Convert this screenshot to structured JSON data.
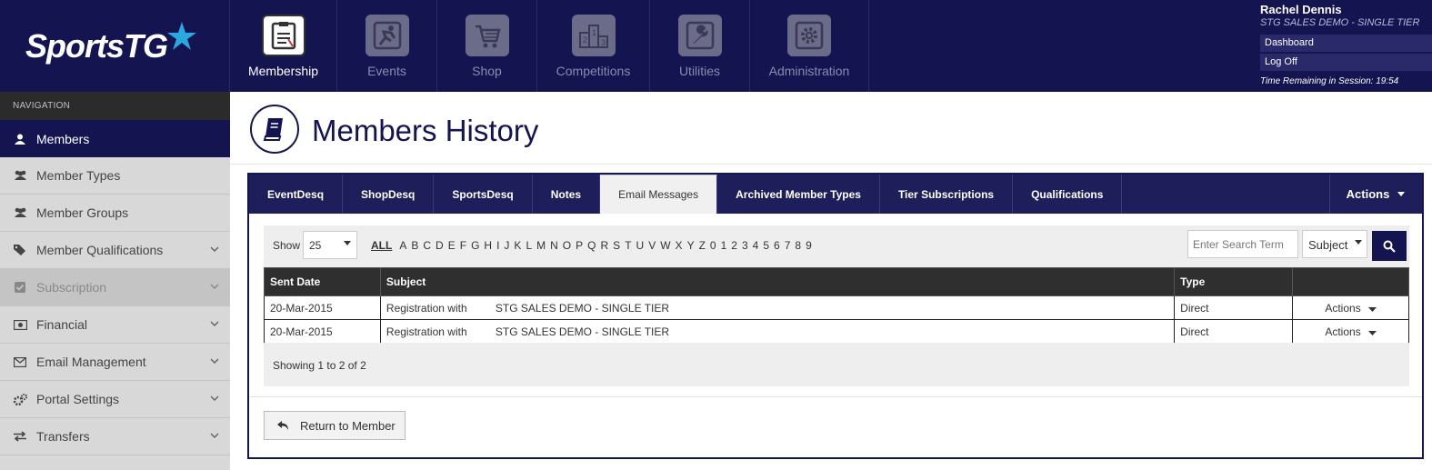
{
  "brand": {
    "name": "SportsTG"
  },
  "topnav": [
    {
      "label": "Membership",
      "icon": "clipboard-icon",
      "active": true
    },
    {
      "label": "Events",
      "icon": "runner-icon",
      "active": false
    },
    {
      "label": "Shop",
      "icon": "cart-icon",
      "active": false
    },
    {
      "label": "Competitions",
      "icon": "podium-icon",
      "active": false
    },
    {
      "label": "Utilities",
      "icon": "wrench-icon",
      "active": false
    },
    {
      "label": "Administration",
      "icon": "gear-icon",
      "active": false
    }
  ],
  "user": {
    "name": "Rachel Dennis",
    "org": "STG SALES DEMO - SINGLE TIER",
    "dashboard_label": "Dashboard",
    "logoff_label": "Log Off",
    "session": "Time Remaining in Session: 19:54"
  },
  "sidebar": {
    "heading": "NAVIGATION",
    "items": [
      {
        "label": "Members",
        "icon": "user-icon"
      },
      {
        "label": "Member Types",
        "icon": "users-icon"
      },
      {
        "label": "Member Groups",
        "icon": "users-icon"
      },
      {
        "label": "Member Qualifications",
        "icon": "tags-icon"
      },
      {
        "label": "Subscription",
        "icon": "checkbox-icon"
      },
      {
        "label": "Financial",
        "icon": "money-icon"
      },
      {
        "label": "Email Management",
        "icon": "envelope-icon"
      },
      {
        "label": "Portal Settings",
        "icon": "cogs-icon"
      },
      {
        "label": "Transfers",
        "icon": "exchange-icon"
      }
    ]
  },
  "page": {
    "title": "Members History",
    "icon": "book-icon"
  },
  "tabs": [
    {
      "label": "EventDesq"
    },
    {
      "label": "ShopDesq"
    },
    {
      "label": "SportsDesq"
    },
    {
      "label": "Notes"
    },
    {
      "label": "Email Messages"
    },
    {
      "label": "Archived Member Types"
    },
    {
      "label": "Tier Subscriptions"
    },
    {
      "label": "Qualifications"
    }
  ],
  "tab_actions_label": "Actions",
  "filter": {
    "show_label": "Show",
    "show_value": "25",
    "alpha_all": "ALL",
    "alpha": [
      "A",
      "B",
      "C",
      "D",
      "E",
      "F",
      "G",
      "H",
      "I",
      "J",
      "K",
      "L",
      "M",
      "N",
      "O",
      "P",
      "Q",
      "R",
      "S",
      "T",
      "U",
      "V",
      "W",
      "X",
      "Y",
      "Z",
      "0",
      "1",
      "2",
      "3",
      "4",
      "5",
      "6",
      "7",
      "8",
      "9"
    ],
    "search_placeholder": "Enter Search Term",
    "search_field": "Subject"
  },
  "table": {
    "headers": {
      "sent_date": "Sent Date",
      "subject": "Subject",
      "type": "Type",
      "actions": ""
    },
    "rows": [
      {
        "sent_date": "20-Mar-2015",
        "subject_a": "Registration with",
        "subject_b": "STG SALES DEMO - SINGLE TIER",
        "type": "Direct",
        "actions": "Actions"
      },
      {
        "sent_date": "20-Mar-2015",
        "subject_a": "Registration with",
        "subject_b": "STG SALES DEMO - SINGLE TIER",
        "type": "Direct",
        "actions": "Actions"
      }
    ],
    "footer": "Showing 1 to 2 of 2"
  },
  "return_button": "Return to Member",
  "colors": {
    "navy": "#141450",
    "tab_bar": "#1e1e5a",
    "sidebar": "#d8d8d8"
  }
}
